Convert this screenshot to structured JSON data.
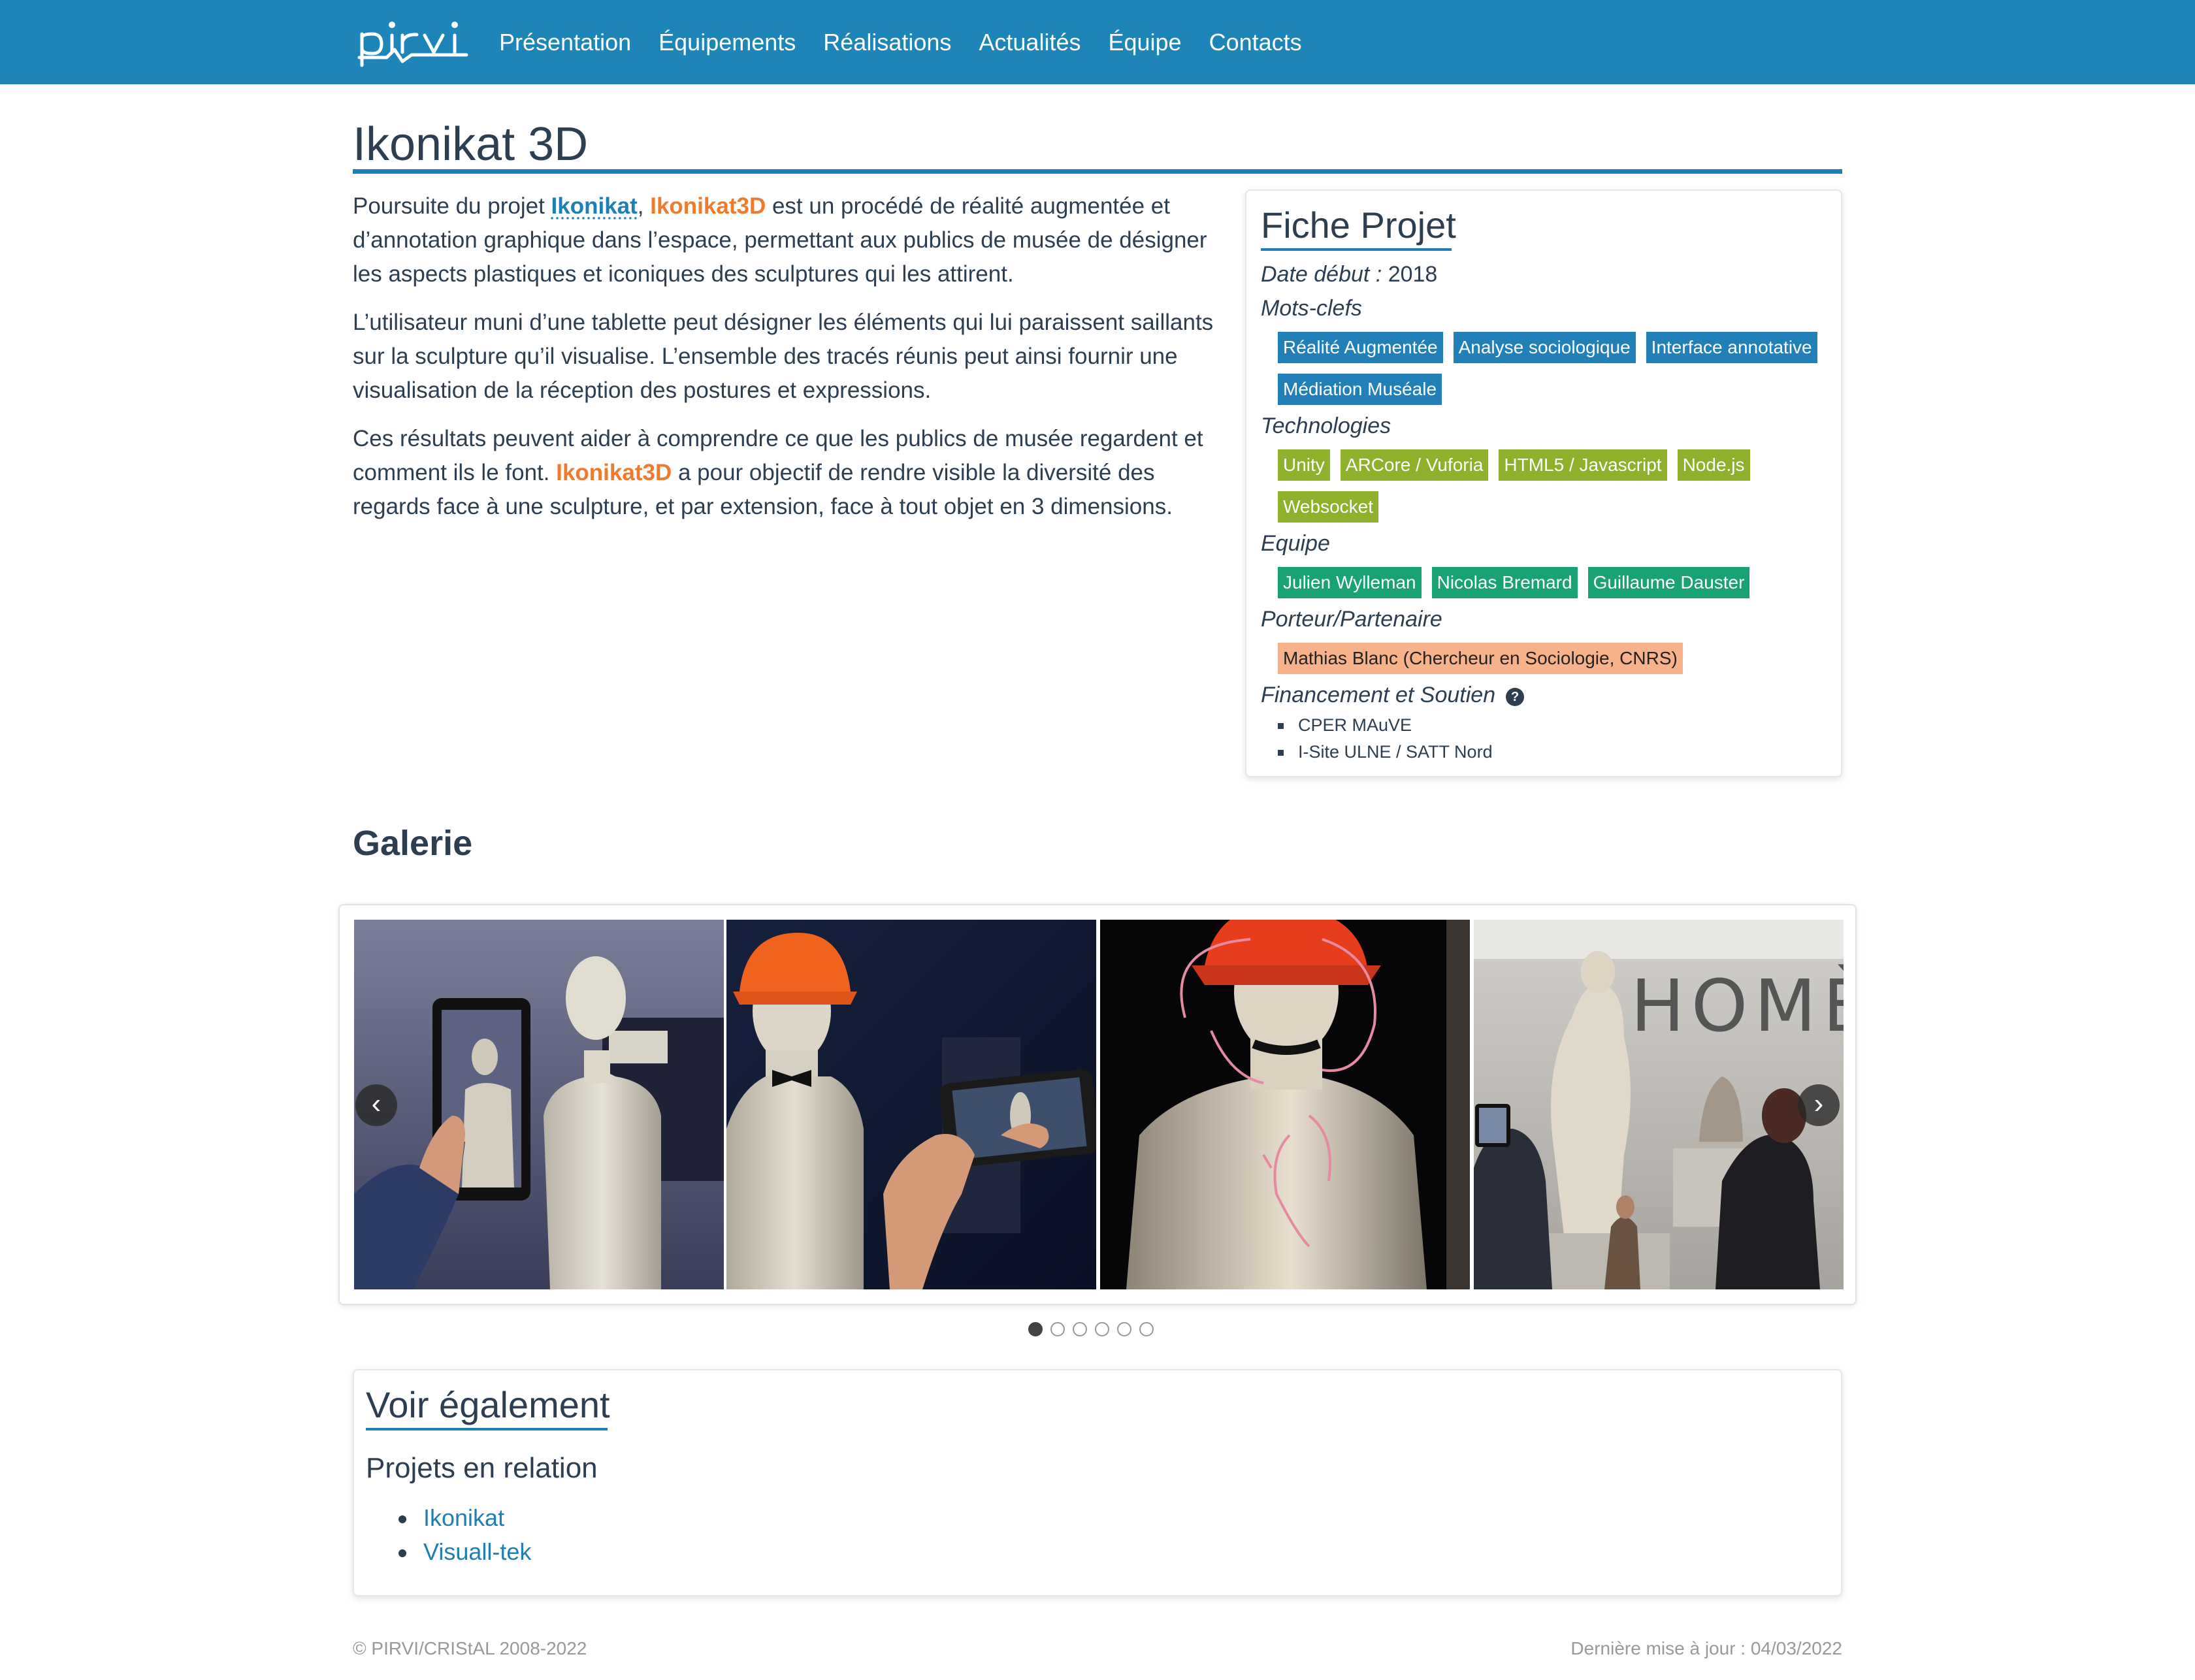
{
  "nav": {
    "logo_text": "pirvi",
    "items": [
      "Présentation",
      "Équipements",
      "Réalisations",
      "Actualités",
      "Équipe",
      "Contacts"
    ]
  },
  "page": {
    "title": "Ikonikat 3D"
  },
  "intro": {
    "p1_before": "Poursuite du projet ",
    "p1_link1": "Ikonikat",
    "p1_sep": ", ",
    "p1_link2": "Ikonikat3D",
    "p1_after": " est un procédé de réalité augmentée et d’annotation graphique dans l’espace, permettant aux publics de musée de désigner les aspects plastiques et iconiques des sculptures qui les attirent.",
    "p2": "L’utilisateur muni d’une tablette peut désigner les éléments qui lui paraissent saillants sur la sculpture qu’il visualise. L’ensemble des tracés réunis peut ainsi fournir une visualisation de la réception des postures et expressions.",
    "p3_before": "Ces résultats peuvent aider à comprendre ce que les publics de musée regardent et comment ils le font. ",
    "p3_link": "Ikonikat3D",
    "p3_after": " a pour objectif de rendre visible la diversité des regards face à une sculpture, et par extension, face à tout objet en 3 dimensions."
  },
  "fiche": {
    "title": "Fiche Projet",
    "date_label": "Date début :",
    "date_value": " 2018",
    "keywords_label": "Mots-clefs",
    "keywords": [
      "Réalité Augmentée",
      "Analyse sociologique",
      "Interface annotative",
      "Médiation Muséale"
    ],
    "tech_label": "Technologies",
    "technologies": [
      "Unity",
      "ARCore / Vuforia",
      "HTML5 / Javascript",
      "Node.js",
      "Websocket"
    ],
    "team_label": "Equipe",
    "team": [
      "Julien Wylleman",
      "Nicolas Bremard",
      "Guillaume Dauster"
    ],
    "partner_label": "Porteur/Partenaire",
    "partners": [
      "Mathias Blanc (Chercheur en Sociologie, CNRS)"
    ],
    "funding_label": "Financement et Soutien",
    "funding_help_icon": "question-circle-icon",
    "funding": [
      "CPER MAuVE",
      "I-Site ULNE / SATT Nord"
    ]
  },
  "gallery": {
    "title": "Galerie",
    "prev": "‹",
    "next": "›",
    "slide_count": 6,
    "active_slide": 1
  },
  "see_also": {
    "title": "Voir également",
    "subtitle": "Projets en relation",
    "items": [
      "Ikonikat",
      "Visuall-tek"
    ]
  },
  "footer": {
    "left": "© PIRVI/CRIStAL 2008-2022",
    "right": "Dernière mise à jour : 04/03/2022"
  },
  "colors": {
    "navbar": "#1e85b9",
    "keyword_tag": "#2180b8",
    "tech_tag": "#8fb02a",
    "team_tag": "#18a276",
    "partner_tag": "#f8b28a",
    "link": "#1e7fb4",
    "highlight": "#f07a2c"
  }
}
